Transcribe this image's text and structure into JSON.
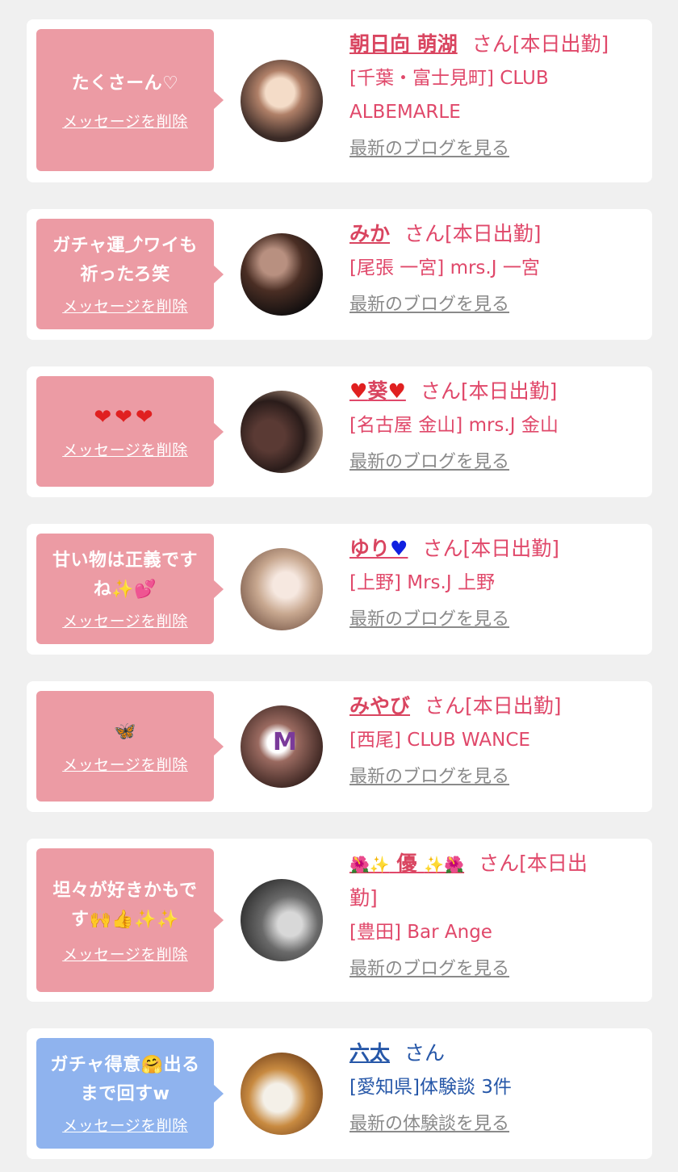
{
  "cards": [
    {
      "message": "たくさーん♡",
      "delete_label": "メッセージを削除",
      "name": "朝日向 萌湖",
      "suffix": "さん[本日出勤]",
      "shop_line1": "[千葉・富士見町] CLUB",
      "shop_line2": "ALBEMARLE",
      "link": "最新のブログを見る",
      "avatar_colors": [
        "#f4dcc8",
        "#7a5a48",
        "#2a2220"
      ]
    },
    {
      "message_line1": "ガチャ運⤴ワイも",
      "message_line2": "祈ったろ笑",
      "delete_label": "メッセージを削除",
      "name": "みか",
      "suffix": "さん[本日出勤]",
      "shop_line1": "[尾張 一宮] mrs.J 一宮",
      "link": "最新のブログを見る",
      "avatar_colors": [
        "#6a4a3a",
        "#2a1a14",
        "#b89080"
      ]
    },
    {
      "message": "❤❤❤",
      "delete_label": "メッセージを削除",
      "name_left_emoji": "♥",
      "name": "葵",
      "name_right_emoji": "♥",
      "suffix": "さん[本日出勤]",
      "shop_line1": "[名古屋 金山] mrs.J 金山",
      "link": "最新のブログを見る",
      "avatar_colors": [
        "#c8a890",
        "#5a3a34",
        "#2a1c1a"
      ]
    },
    {
      "message_line1": "甘い物は正義です",
      "message_line2": "ね✨💕",
      "delete_label": "メッセージを削除",
      "name": "ゆり",
      "name_right_emoji": "♥",
      "suffix": "さん[本日出勤]",
      "shop_line1": "[上野] Mrs.J 上野",
      "link": "最新のブログを見る",
      "avatar_colors": [
        "#f2e8e0",
        "#c8a890",
        "#7a5a48"
      ]
    },
    {
      "message": "🦋",
      "delete_label": "メッセージを削除",
      "name": "みやび",
      "suffix": "さん[本日出勤]",
      "shop_line1": "[西尾] CLUB WANCE",
      "link": "最新のブログを見る",
      "avatar_letter": "M",
      "avatar_colors": [
        "#7a5048",
        "#3a2420",
        "#e8d0c8"
      ]
    },
    {
      "message_line1": "坦々が好きかもで",
      "message_line2": "す🙌👍✨✨",
      "delete_label": "メッセージを削除",
      "name_left_emoji": "🌺✨",
      "name": "優",
      "name_right_emoji": "✨🌺",
      "suffix": "さん[本日出",
      "suffix_line2": "勤]",
      "shop_line1": "[豊田] Bar Ange",
      "link": "最新のブログを見る",
      "avatar_colors": [
        "#8a9098",
        "#3a3a3a",
        "#d8d8d8"
      ]
    },
    {
      "message_line1": "ガチャ得意🤗出る",
      "message_line2": "まで回すw",
      "delete_label": "メッセージを削除",
      "name": "六太",
      "suffix": "さん",
      "shop_line1": "[愛知県]体験談 3件",
      "link": "最新の体験談を見る",
      "avatar_colors": [
        "#c88a40",
        "#f4f0e8",
        "#7a4a20"
      ]
    }
  ]
}
